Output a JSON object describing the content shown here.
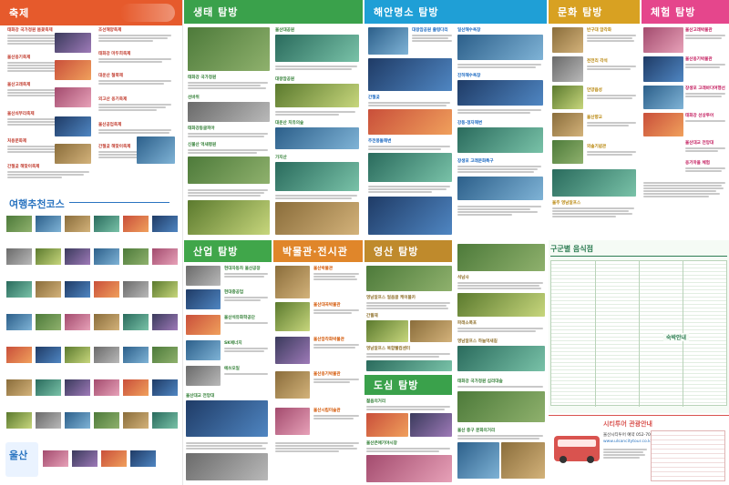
{
  "sections": {
    "festival": "축제",
    "course": "여행추천코스",
    "eco": "생태 탐방",
    "sea": "해안명소 탐방",
    "culture": "문화 탐방",
    "experience": "체험 탐방",
    "industry": "산업 탐방",
    "museum": "박물관·전시관",
    "yeongnam": "영산 탐방",
    "city": "도심 탐방",
    "restaurant": "구군별 음식점",
    "lodging": "숙박안내",
    "citytour": "시티투어 관광안내"
  },
  "festival_items": [
    "태화강 국가정원 봄꽃축제",
    "울산옹기축제",
    "울산고래축제",
    "울산쇠부리축제",
    "처용문화제",
    "간절곶 해맞이축제"
  ],
  "festival_items_right": [
    "조선해양축제",
    "태화강 마두희축제",
    "대운산 철쭉제",
    "외고산 옹기축제",
    "울산공업축제",
    "간절곶 해맞이축제"
  ],
  "eco_items": [
    "태화강 국가정원",
    "울산대공원",
    "대왕암공원",
    "선바위",
    "태화강동굴피아",
    "대운산 치유의숲",
    "신불산 억새평원",
    "가지산"
  ],
  "sea_items": [
    "대왕암공원 출렁다리",
    "간절곶",
    "주전몽돌해변",
    "일산해수욕장",
    "진하해수욕장",
    "강동·정자해변",
    "장생포 고래문화특구"
  ],
  "culture_items": [
    "반구대 암각화",
    "천전리 각석",
    "언양읍성",
    "울산향교",
    "외솔기념관",
    "울주 영남알프스"
  ],
  "experience_items": [
    "울산고래박물관",
    "울산옹기박물관",
    "장생포 고래바다여행선",
    "태화강 선상투어",
    "울산대교 전망대",
    "옹기마을 체험"
  ],
  "industry_items": [
    "현대자동차 울산공장",
    "현대중공업",
    "울산석유화학공단",
    "SK에너지",
    "에쓰오일",
    "울산대교 전망대"
  ],
  "museum_items": [
    "울산박물관",
    "울산대곡박물관",
    "울산암각화박물관",
    "울산옹기박물관",
    "울산시립미술관"
  ],
  "yeongnam_items": [
    "영남알프스 얼음골 케이블카",
    "간월재",
    "영남알프스 복합웰컴센터"
  ],
  "yeongnam_right": [
    "석남사",
    "파래소폭포",
    "영남알프스 하늘억새길"
  ],
  "city_items": [
    "젊음의거리",
    "울산큰애기야시장",
    "태화강 국가정원 십리대숲",
    "울산 중구 문화의거리"
  ],
  "brand_title": "울산",
  "citytour_tagline": "울산시티투어 예약 052-700-7070",
  "citytour_url": "www.ulsancitytour.co.kr",
  "colors": {
    "festival": "#e65a2c",
    "course": "#2a74c0",
    "eco": "#3aa14b",
    "sea": "#1f9fd6",
    "culture": "#d8a122",
    "experience": "#e5468c",
    "industry": "#40a64a",
    "museum": "#e0862a",
    "yeongnam": "#bf8a2c",
    "city": "#3aa14b",
    "restaurant": "#2d7d53"
  }
}
